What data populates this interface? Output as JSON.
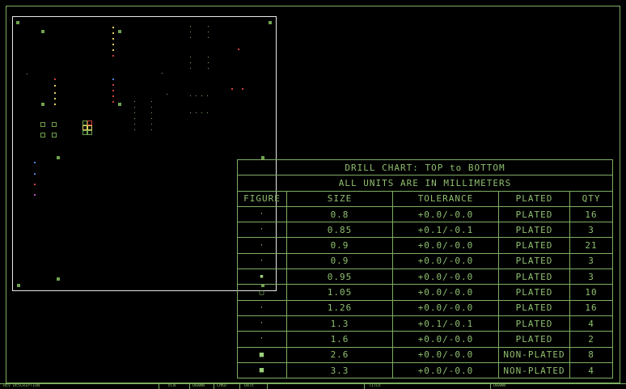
{
  "colors": {
    "background": "#000000",
    "frame": "#7fae62",
    "board_outline": "#e8e8e8",
    "text": "#8fbf6f",
    "pad": "#6fa24f",
    "drill_red": "#d04040",
    "drill_yellow": "#e0d060",
    "drill_blue": "#5080e0",
    "drill_magenta": "#c050c0"
  },
  "drill_chart": {
    "title": "DRILL CHART: TOP to BOTTOM",
    "subtitle": "ALL UNITS ARE IN MILLIMETERS",
    "headers": [
      "FIGURE",
      "SIZE",
      "TOLERANCE",
      "PLATED",
      "QTY"
    ],
    "rows": [
      {
        "figure": "·",
        "size": "0.8",
        "tolerance": "+0.0/-0.0",
        "plated": "PLATED",
        "qty": "16"
      },
      {
        "figure": "·",
        "size": "0.85",
        "tolerance": "+0.1/-0.1",
        "plated": "PLATED",
        "qty": "3"
      },
      {
        "figure": "·",
        "size": "0.9",
        "tolerance": "+0.0/-0.0",
        "plated": "PLATED",
        "qty": "21"
      },
      {
        "figure": "·",
        "size": "0.9",
        "tolerance": "+0.0/-0.0",
        "plated": "PLATED",
        "qty": "3"
      },
      {
        "figure": "▪",
        "size": "0.95",
        "tolerance": "+0.0/-0.0",
        "plated": "PLATED",
        "qty": "3"
      },
      {
        "figure": "□",
        "size": "1.05",
        "tolerance": "+0.0/-0.0",
        "plated": "PLATED",
        "qty": "10"
      },
      {
        "figure": "·",
        "size": "1.26",
        "tolerance": "+0.0/-0.0",
        "plated": "PLATED",
        "qty": "16"
      },
      {
        "figure": "·",
        "size": "1.3",
        "tolerance": "+0.1/-0.1",
        "plated": "PLATED",
        "qty": "4"
      },
      {
        "figure": "·",
        "size": "1.6",
        "tolerance": "+0.0/-0.0",
        "plated": "PLATED",
        "qty": "2"
      },
      {
        "figure": "■",
        "size": "2.6",
        "tolerance": "+0.0/-0.0",
        "plated": "NON-PLATED",
        "qty": "8"
      },
      {
        "figure": "■",
        "size": "3.3",
        "tolerance": "+0.0/-0.0",
        "plated": "NON-PLATED",
        "qty": "4"
      }
    ]
  },
  "title_block": {
    "fields": [
      "REV DESCRIPTION",
      "ECN",
      "DRAWN",
      "CHKD",
      "DATE",
      "TITLE",
      "DRAWN"
    ]
  }
}
